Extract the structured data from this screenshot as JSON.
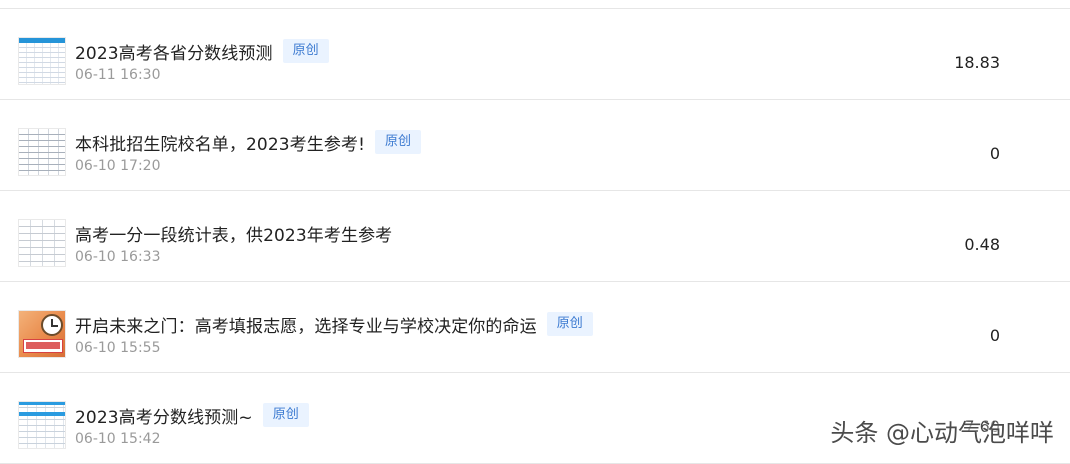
{
  "items": [
    {
      "title": "2023高考各省分数线预测",
      "badge": "原创",
      "time": "06-11 16:30",
      "metric": "18.83",
      "thumb_icon": "table-thumbnail"
    },
    {
      "title": "本科批招生院校名单，2023考生参考!",
      "badge": "原创",
      "time": "06-10 17:20",
      "metric": "0",
      "thumb_icon": "document-thumbnail"
    },
    {
      "title": "高考一分一段统计表，供2023年考生参考",
      "badge": "",
      "time": "06-10 16:33",
      "metric": "0.48",
      "thumb_icon": "grid-thumbnail"
    },
    {
      "title": "开启未来之门：高考填报志愿，选择专业与学校决定你的命运",
      "badge": "原创",
      "time": "06-10 15:55",
      "metric": "0",
      "thumb_icon": "clock-thumbnail"
    },
    {
      "title": "2023高考分数线预测~",
      "badge": "原创",
      "time": "06-10 15:42",
      "metric": "7.60",
      "thumb_icon": "table-thumbnail"
    }
  ],
  "watermark": "头条 @心动气泡咩咩",
  "colors": {
    "badge_text": "#3d7bd1",
    "badge_bg": "#eaf3ff",
    "divider": "#e6e6e6",
    "time_text": "#9a9a9a"
  }
}
